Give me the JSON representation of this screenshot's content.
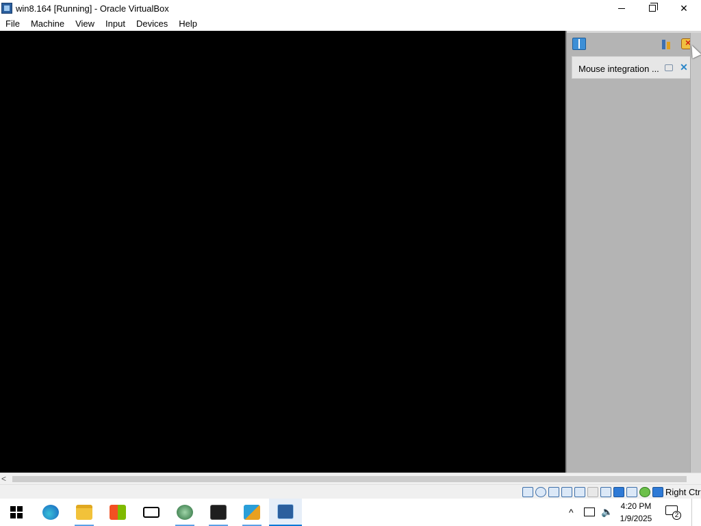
{
  "window": {
    "title": "win8.164 [Running] - Oracle VirtualBox"
  },
  "menubar": {
    "items": [
      "File",
      "Machine",
      "View",
      "Input",
      "Devices",
      "Help"
    ]
  },
  "notification_panel": {
    "items": [
      {
        "text": "Mouse integration ..."
      }
    ]
  },
  "statusbar": {
    "icons": [
      "hard-disk-icon",
      "optical-drive-icon",
      "audio-icon",
      "network-icon",
      "usb-icon",
      "shared-folders-icon",
      "display-icon",
      "recording-icon",
      "video-capture-icon",
      "virtualization-icon",
      "cpu-activity-icon",
      "mouse-integration-icon",
      "keyboard-capture-icon"
    ],
    "host_key": "Right Ctrl"
  },
  "taskbar": {
    "apps": [
      "start",
      "edge",
      "file-explorer",
      "microsoft-store",
      "mail",
      "network-app",
      "terminal",
      "visual-studio",
      "virtualbox"
    ],
    "clock": {
      "time": "4:20 PM",
      "date": "1/9/2025"
    },
    "notification_count": "2"
  }
}
